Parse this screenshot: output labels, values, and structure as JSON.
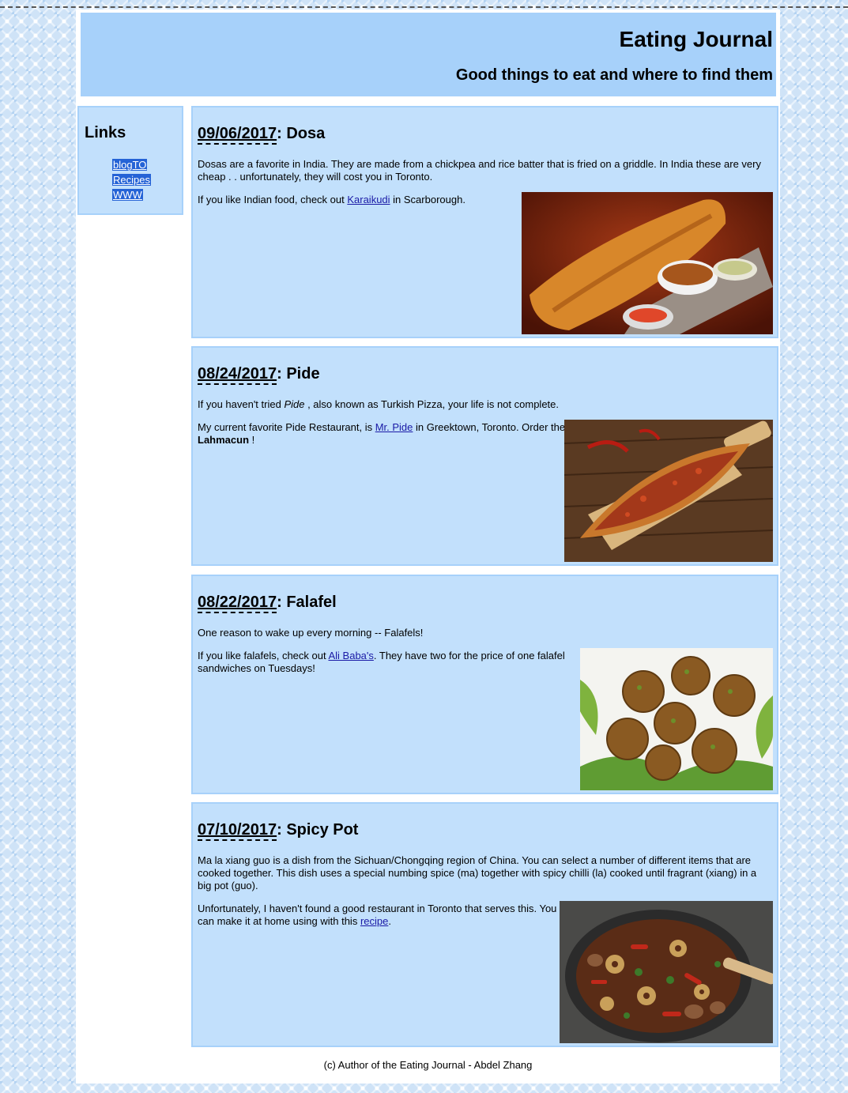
{
  "header": {
    "title": "Eating Journal",
    "tagline": "Good things to eat and where to find them"
  },
  "sidebar": {
    "heading": "Links",
    "links": [
      {
        "label": "blogTO"
      },
      {
        "label": "Recipes"
      },
      {
        "label": "WWW"
      }
    ]
  },
  "posts": [
    {
      "date": "09/06/2017",
      "sep": ": ",
      "name": "Dosa",
      "p1": "Dosas are a favorite in India. They are made from a chickpea and rice batter that is fried on a griddle. In India these are very cheap . . unfortunately, they will cost you in Toronto.",
      "p2_before": "If you like Indian food, check out ",
      "p2_link": "Karaikudi",
      "p2_after": " in Scarborough.",
      "image_icon": "dosa-photo"
    },
    {
      "date": "08/24/2017",
      "sep": ": ",
      "name": "Pide",
      "p1_before": "If you haven't tried ",
      "p1_em": "Pide",
      "p1_after": " , also known as Turkish Pizza, your life is not complete.",
      "p2_before": "My current favorite Pide Restaurant, is ",
      "p2_link": "Mr. Pide",
      "p2_mid": " in Greektown, Toronto. Order the ",
      "p2_strong": "Lahmacun",
      "p2_after": " !",
      "image_icon": "pide-photo"
    },
    {
      "date": "08/22/2017",
      "sep": ": ",
      "name": "Falafel",
      "p1": "One reason to wake up every morning -- Falafels!",
      "p2_before": "If you like falafels, check out ",
      "p2_link": "Ali Baba's",
      "p2_after": ". They have two for the price of one falafel sandwiches on Tuesdays!",
      "image_icon": "falafel-photo"
    },
    {
      "date": "07/10/2017",
      "sep": ": ",
      "name": "Spicy Pot",
      "p1": "Ma la xiang guo is a dish from the Sichuan/Chongqing region of China. You can select a number of different items that are cooked together. This dish uses a special numbing spice (ma) together with spicy chilli (la) cooked until fragrant (xiang) in a big pot (guo).",
      "p2_before": "Unfortunately, I haven't found a good restaurant in Toronto that serves this. You can make it at home using with this ",
      "p2_link": "recipe",
      "p2_after": ".",
      "image_icon": "spicy-pot-photo"
    }
  ],
  "footer": {
    "text": "(c) Author of the Eating Journal - Abdel Zhang"
  },
  "colors": {
    "panel": "#c2e0fc",
    "masthead": "#a7d1fa",
    "link_highlight": "#2563d6",
    "link": "#1a1aa6"
  }
}
